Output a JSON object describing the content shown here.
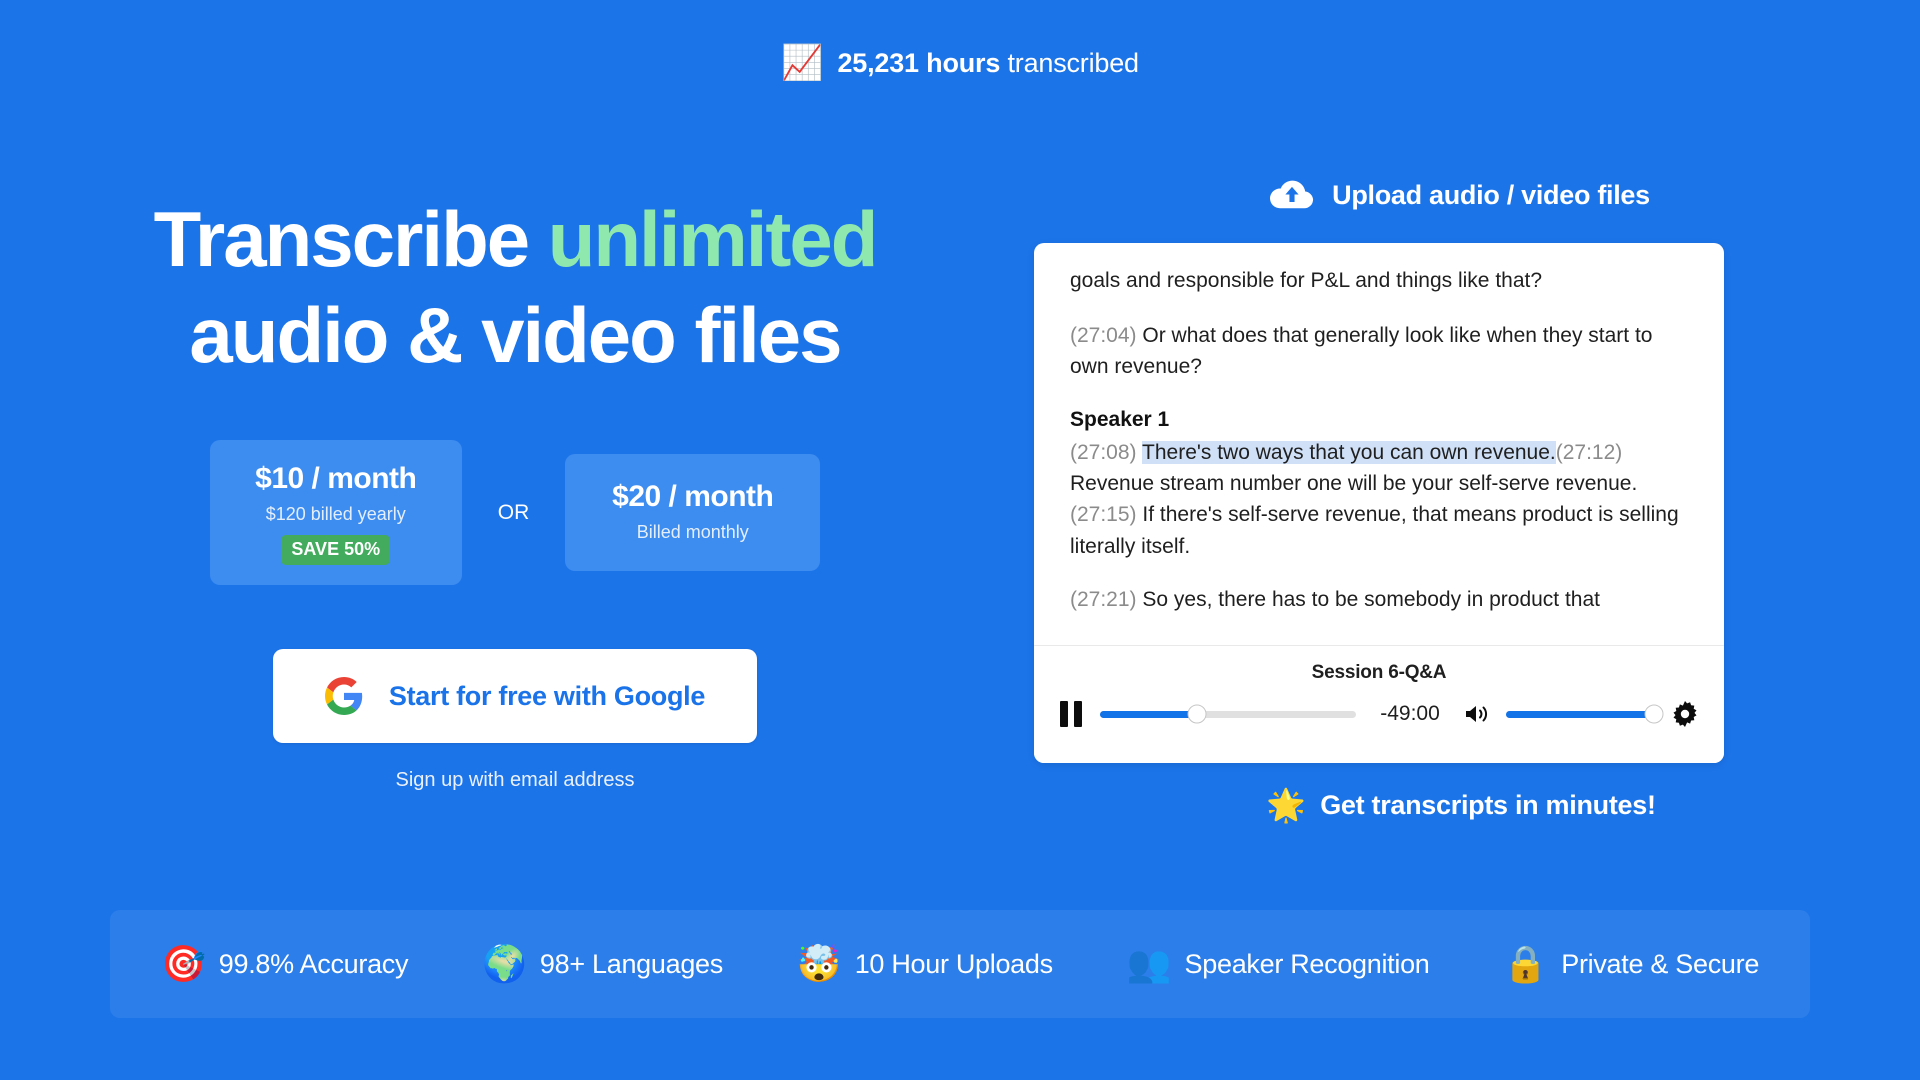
{
  "header": {
    "icon": "chart-increasing-icon",
    "icon_glyph": "📈",
    "count": "25,231 hours",
    "suffix": " transcribed"
  },
  "hero": {
    "headline_part1": "Transcribe ",
    "headline_accent": "unlimited",
    "headline_line2": "audio & video files",
    "accent_color": "#8fe8ae"
  },
  "pricing": {
    "yearly": {
      "amount": "$10 / month",
      "sub": "$120 billed yearly",
      "badge": "SAVE 50%",
      "badge_color": "#42ab5d"
    },
    "separator": "OR",
    "monthly": {
      "amount": "$20 / month",
      "sub": "Billed monthly"
    }
  },
  "cta": {
    "google_icon": "google-g-icon",
    "google_label": "Start for free with Google",
    "email_label": "Sign up with email address"
  },
  "upload": {
    "icon": "upload-cloud-icon",
    "label": "Upload audio / video files"
  },
  "transcript": {
    "paragraphs": [
      {
        "type": "text",
        "timestamp": "",
        "text": "goals and responsible for P&L and things like that?"
      },
      {
        "type": "text",
        "timestamp": "(27:04)",
        "text": " Or what does that generally look like when they start to own revenue?"
      }
    ],
    "speaker_label": "Speaker 1",
    "highlight_timestamp": "(27:08)",
    "highlight_text": "There's two ways that you can own revenue.",
    "after_highlight_ts": "(27:12)",
    "after_highlight_text": " Revenue stream number one will be your self-serve revenue. ",
    "inline_ts": "(27:15)",
    "inline_text": " If there's self-serve revenue, that means product is selling literally itself.",
    "last_ts": "(27:21)",
    "last_text": " So yes, there has to be somebody in product that",
    "highlight_color": "#cfe0f7"
  },
  "player": {
    "title": "Session 6-Q&A",
    "pause_icon": "pause-icon",
    "time_remaining": "-49:00",
    "volume_icon": "volume-high-icon",
    "settings_icon": "gear-icon",
    "progress_percent": 38,
    "volume_percent": 100,
    "accent_color": "#1272e8"
  },
  "tagline": {
    "emoji": "🌟",
    "icon": "glowing-star-icon",
    "text": "Get transcripts in minutes!"
  },
  "features": [
    {
      "emoji": "🎯",
      "icon": "dart-target-icon",
      "label": "99.8% Accuracy"
    },
    {
      "emoji": "🌍",
      "icon": "globe-icon",
      "label": "98+ Languages"
    },
    {
      "emoji": "🤯",
      "icon": "mind-blown-icon",
      "label": "10 Hour Uploads"
    },
    {
      "emoji": "👥",
      "icon": "busts-silhouette-icon",
      "label": "Speaker Recognition"
    },
    {
      "emoji": "🔒",
      "icon": "lock-icon",
      "label": "Private & Secure"
    }
  ]
}
